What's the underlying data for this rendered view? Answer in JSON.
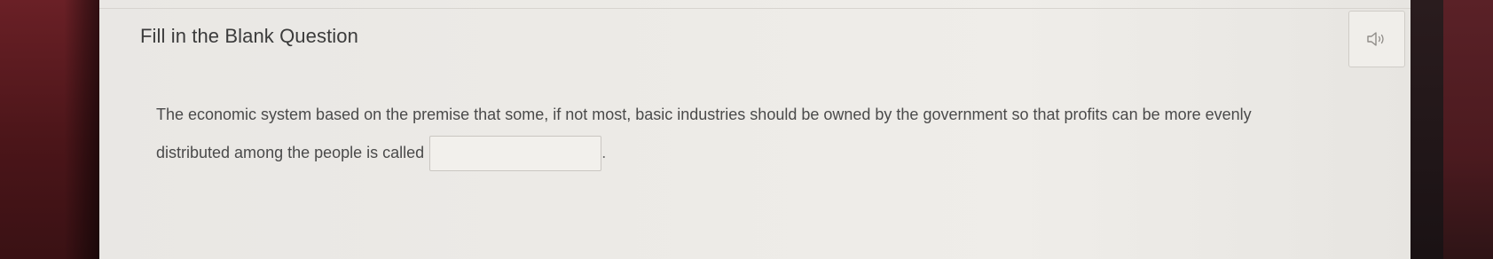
{
  "header": {
    "title": "Fill in the Blank Question"
  },
  "audio_button": {
    "icon": "speaker-icon"
  },
  "question": {
    "line_one": "The economic system based on the premise that some, if not most, basic industries should be owned by the government so that profits can be more evenly",
    "line_two": "distributed among the people is called",
    "blank_value": "",
    "trailing": "."
  }
}
